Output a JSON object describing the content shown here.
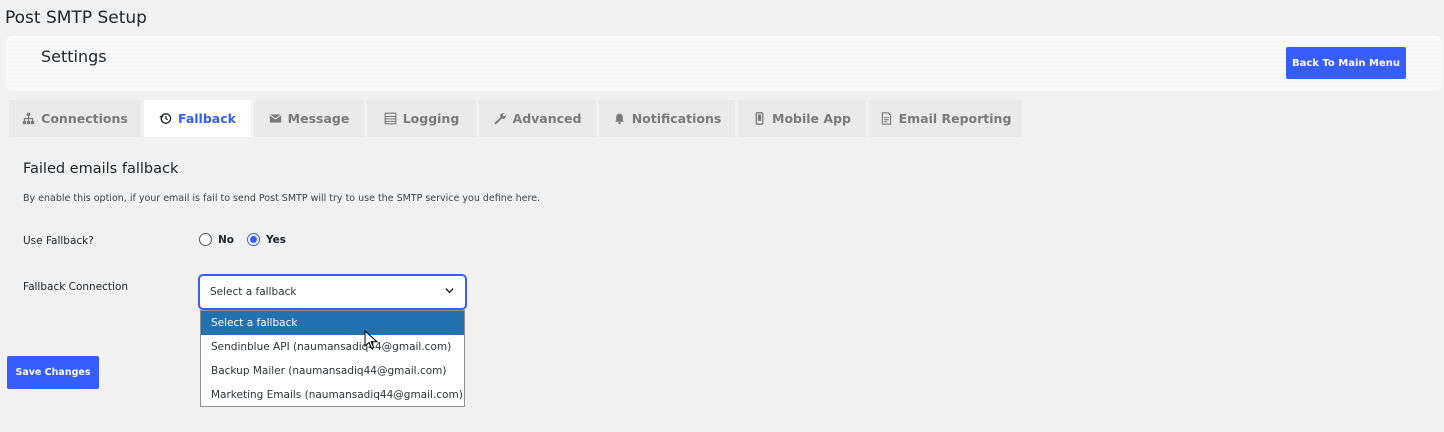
{
  "page": {
    "title": "Post SMTP Setup"
  },
  "header": {
    "settings_title": "Settings",
    "back_label": "Back To Main Menu"
  },
  "tabs": [
    {
      "label": "Connections",
      "icon": "sitemap-icon"
    },
    {
      "label": "Fallback",
      "icon": "history-icon",
      "active": true
    },
    {
      "label": "Message",
      "icon": "envelope-icon"
    },
    {
      "label": "Logging",
      "icon": "list-icon"
    },
    {
      "label": "Advanced",
      "icon": "wrench-icon"
    },
    {
      "label": "Notifications",
      "icon": "bell-icon"
    },
    {
      "label": "Mobile App",
      "icon": "mobile-icon"
    },
    {
      "label": "Email Reporting",
      "icon": "report-icon"
    }
  ],
  "fallback": {
    "heading": "Failed emails fallback",
    "description": "By enable this option, if your email is fail to send Post SMTP will try to use the SMTP service you define here.",
    "use_label": "Use Fallback?",
    "option_no": "No",
    "option_yes": "Yes",
    "selected": "Yes",
    "connection_label": "Fallback Connection",
    "select_value": "Select a fallback",
    "options": [
      "Select a fallback",
      "Sendinblue API (naumansadiq44@gmail.com)",
      "Backup Mailer (naumansadiq44@gmail.com)",
      "Marketing Emails (naumansadiq44@gmail.com)"
    ]
  },
  "footer": {
    "save_label": "Save Changes"
  },
  "colors": {
    "accent": "#375cff",
    "option_highlight": "#2271b1"
  }
}
